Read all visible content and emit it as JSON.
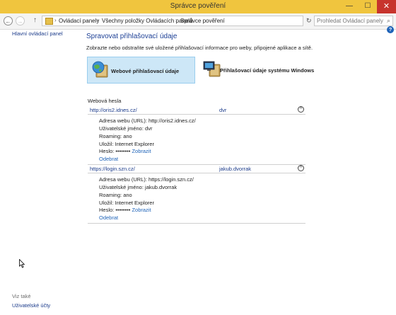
{
  "window": {
    "title": "Správce pověření",
    "minimize": "—",
    "maximize": "☐",
    "close": "✕"
  },
  "nav": {
    "back": "←",
    "forward": "→",
    "up": "↑",
    "breadcrumbs": [
      "Ovládací panely",
      "Všechny položky Ovládacích panelů",
      "Správce pověření"
    ],
    "separator": "›",
    "refresh": "↻",
    "search_placeholder": "Prohledat Ovládací panely",
    "search_icon": "⌕"
  },
  "sidebar": {
    "home_link": "Hlavní ovládací panel",
    "see_also": "Viz také",
    "user_accounts": "Uživatelské účty"
  },
  "help_icon": "?",
  "main": {
    "title": "Spravovat přihlašovací údaje",
    "subtitle": "Zobrazte nebo odstraňte své uložené přihlašovací informace pro weby, připojené aplikace a sítě.",
    "categories": [
      {
        "label": "Webové přihlašovací údaje",
        "icon": "web-credentials-icon",
        "selected": true
      },
      {
        "label": "Přihlašovací údaje systému Windows",
        "icon": "windows-credentials-icon",
        "selected": false
      }
    ],
    "section_title": "Webová hesla",
    "entries": [
      {
        "url": "http://oris2.idnes.cz/",
        "user": "dvr",
        "collapse": "^",
        "address_label": "Adresa webu (URL):",
        "address_value": "http://oris2.idnes.cz/",
        "username_label": "Uživatelské jméno:",
        "username_value": "dvr",
        "roaming_label": "Roaming:",
        "roaming_value": "ano",
        "saved_by_label": "Uložil:",
        "saved_by_value": "Internet Explorer",
        "password_label": "Heslo:",
        "password_value": "••••••••",
        "show_link": "Zobrazit",
        "remove_link": "Odebrat"
      },
      {
        "url": "https://login.szn.cz/",
        "user": "jakub.dvorrak",
        "collapse": "^",
        "address_label": "Adresa webu (URL):",
        "address_value": "https://login.szn.cz/",
        "username_label": "Uživatelské jméno:",
        "username_value": "jakub.dvorrak",
        "roaming_label": "Roaming:",
        "roaming_value": "ano",
        "saved_by_label": "Uložil:",
        "saved_by_value": "Internet Explorer",
        "password_label": "Heslo:",
        "password_value": "••••••••",
        "show_link": "Zobrazit",
        "remove_link": "Odebrat"
      }
    ]
  },
  "colors": {
    "titlebar": "#f0c53e",
    "close_button": "#c7342d",
    "link": "#1e63b8",
    "heading": "#1c3f95",
    "selected_tile": "#cde7f7"
  }
}
